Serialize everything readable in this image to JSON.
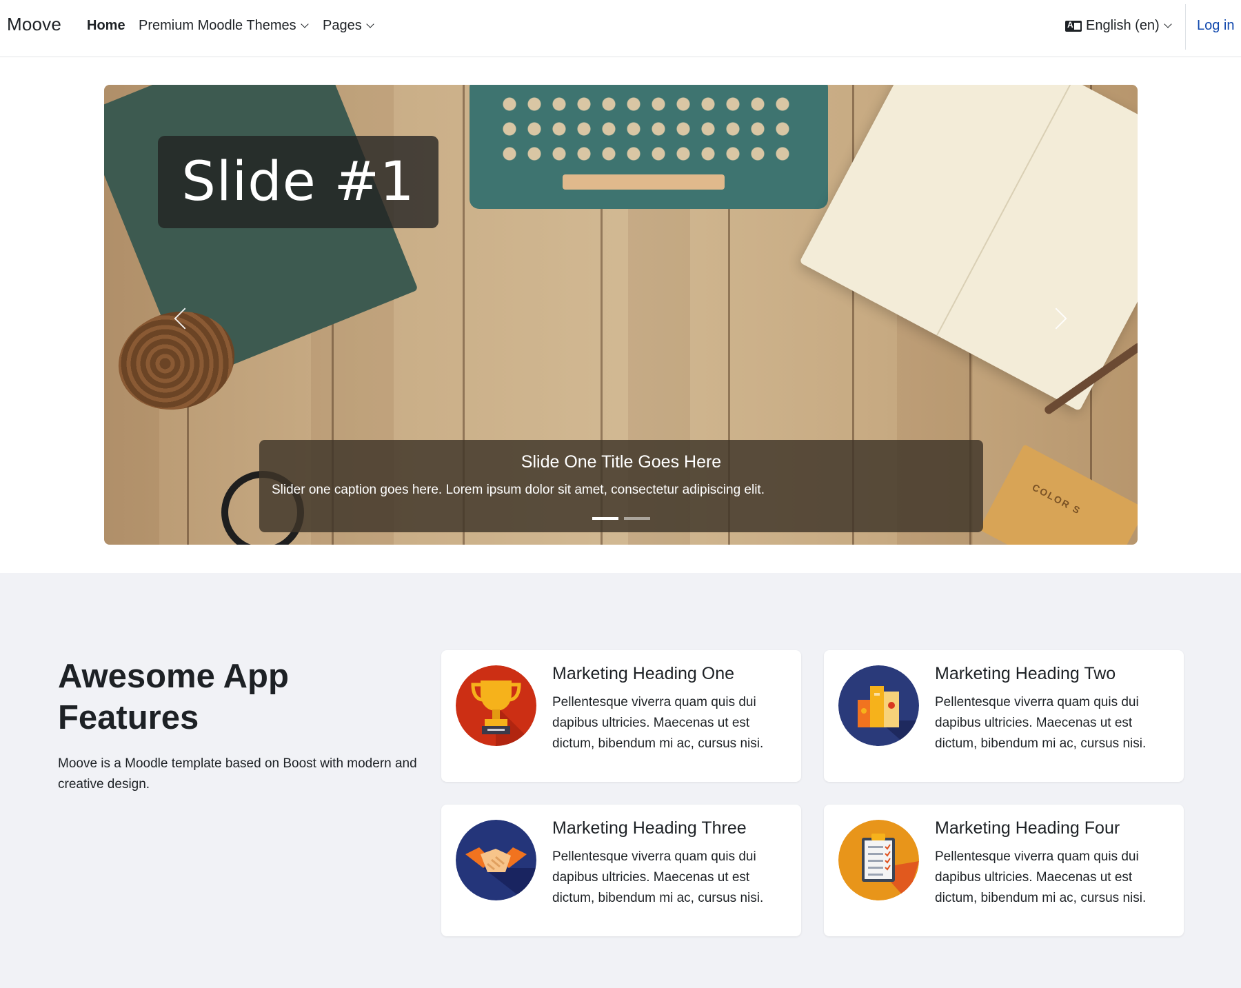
{
  "navbar": {
    "brand": "Moove",
    "home_label": "Home",
    "themes_label": "Premium Moodle Themes",
    "pages_label": "Pages",
    "language_label": "English (en)",
    "login_label": "Log in"
  },
  "carousel": {
    "slide_heading": "Slide #1",
    "caption_title": "Slide One Title Goes Here",
    "caption_text": "Slider one caption goes here. Lorem ipsum dolor sit amet, consectetur adipiscing elit.",
    "box_label": "COLOR S",
    "indicator_count": 2,
    "active_indicator": 1
  },
  "features": {
    "heading": "Awesome App Features",
    "description": "Moove is a Moodle template based on Boost with modern and creative design.",
    "cards": [
      {
        "title": "Marketing Heading One",
        "text": "Pellentesque viverra quam quis dui dapibus ultricies. Maecenas ut est dictum, bibendum mi ac, cursus nisi.",
        "icon": "trophy-icon",
        "icon_color": "#cc2f14"
      },
      {
        "title": "Marketing Heading Two",
        "text": "Pellentesque viverra quam quis dui dapibus ultricies. Maecenas ut est dictum, bibendum mi ac, cursus nisi.",
        "icon": "books-icon",
        "icon_color": "#2a3a7a"
      },
      {
        "title": "Marketing Heading Three",
        "text": "Pellentesque viverra quam quis dui dapibus ultricies. Maecenas ut est dictum, bibendum mi ac, cursus nisi.",
        "icon": "handshake-icon",
        "icon_color": "#24357a"
      },
      {
        "title": "Marketing Heading Four",
        "text": "Pellentesque viverra quam quis dui dapibus ultricies. Maecenas ut est dictum, bibendum mi ac, cursus nisi.",
        "icon": "checklist-icon",
        "icon_color": "#e8951a"
      }
    ]
  }
}
